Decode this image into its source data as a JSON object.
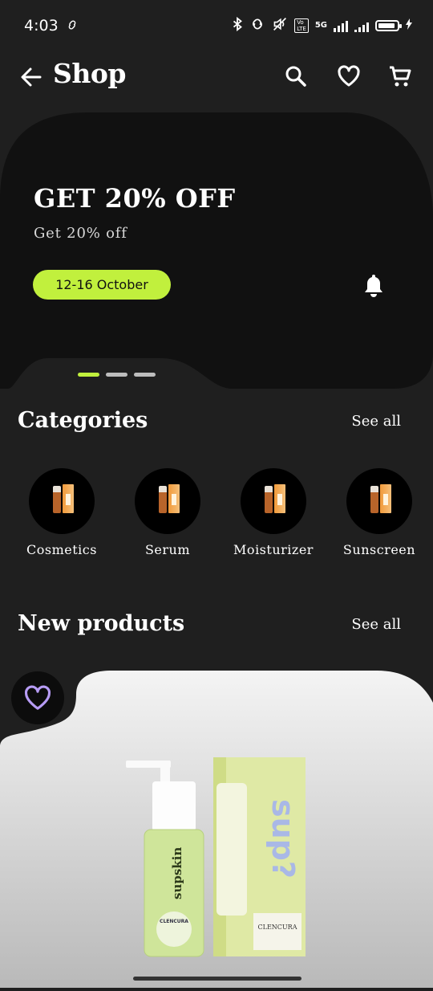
{
  "status": {
    "time": "4:03",
    "network": "5G"
  },
  "header": {
    "title": "Shop"
  },
  "banner": {
    "title": "GET 20% OFF",
    "subtitle": "Get 20% off",
    "date_range": "12-16 October",
    "slide_count": 3,
    "active_slide": 1
  },
  "categories": {
    "title": "Categories",
    "see_all": "See all",
    "items": [
      {
        "label": "Cosmetics"
      },
      {
        "label": "Serum"
      },
      {
        "label": "Moisturizer"
      },
      {
        "label": "Sunscreen"
      }
    ]
  },
  "new_products": {
    "title": "New products",
    "see_all": "See all",
    "product": {
      "bottle_brand": "supskin",
      "box_brand": "sup?",
      "bottle_name": "CLENCURA",
      "box_name": "CLENCURA"
    }
  },
  "colors": {
    "background": "#1f1f1f",
    "banner": "#111111",
    "accent": "#c1f03d",
    "favorite_icon": "#b79cf5"
  }
}
